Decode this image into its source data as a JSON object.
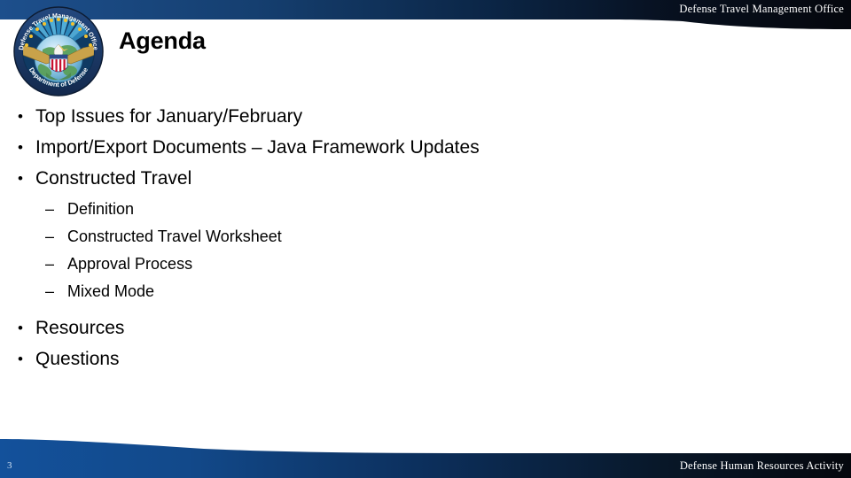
{
  "header": {
    "org_text": "Defense Travel Management Office",
    "gradient_left": "#1d4f8c",
    "gradient_right": "#05070d"
  },
  "seal": {
    "top_arc_text": "Defense Travel Management Office",
    "bottom_arc_text": "Department of Defense",
    "ring_color": "#1b3d6e",
    "ray_color": "#2f8fc4",
    "star_color": "#f2c230"
  },
  "title": {
    "text": "Agenda"
  },
  "content": {
    "bullet_marker": "•",
    "sub_marker": "–",
    "items": [
      {
        "label": "Top Issues for January/February"
      },
      {
        "label": "Import/Export Documents – Java Framework Updates"
      },
      {
        "label": "Constructed Travel",
        "subitems": [
          {
            "label": "Definition"
          },
          {
            "label": "Constructed Travel Worksheet"
          },
          {
            "label": "Approval Process"
          },
          {
            "label": "Mixed Mode"
          }
        ]
      },
      {
        "label": "Resources"
      },
      {
        "label": "Questions"
      }
    ]
  },
  "footer": {
    "page_number": "3",
    "org_text": "Defense Human Resources Activity",
    "gradient_left": "#13519b",
    "gradient_right": "#05070d"
  }
}
